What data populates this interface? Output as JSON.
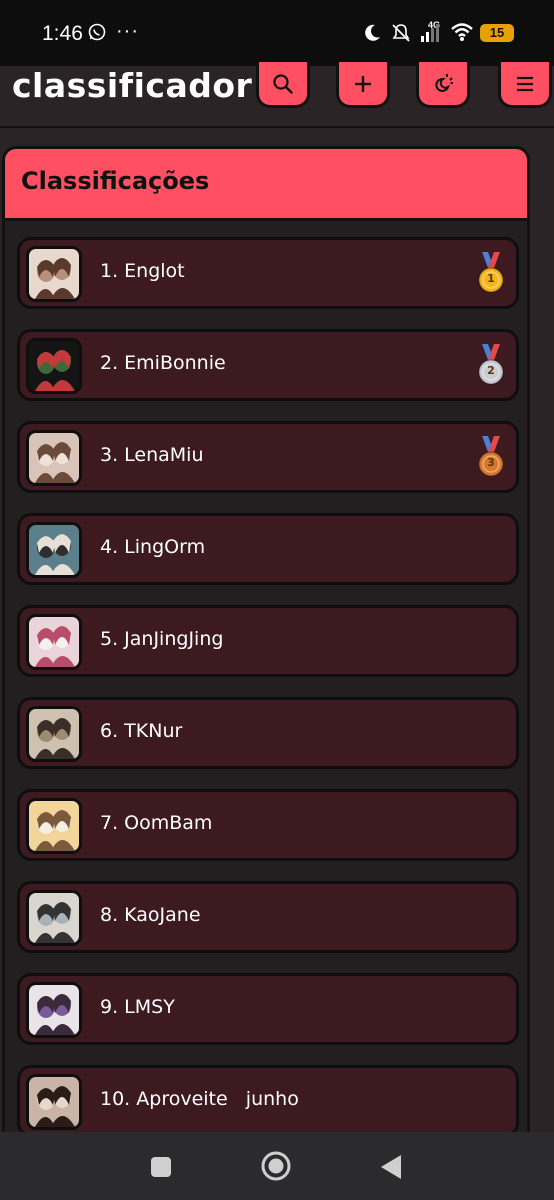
{
  "status_bar": {
    "time": "1:46",
    "more": "···",
    "network": "4G",
    "battery": "15"
  },
  "header": {
    "title": "classificador"
  },
  "panel": {
    "title": "Classificações"
  },
  "rankings": [
    {
      "label": "1. Englot",
      "medal": "gold",
      "medal_number": "1"
    },
    {
      "label": "2. EmiBonnie",
      "medal": "silver",
      "medal_number": "2"
    },
    {
      "label": "3. LenaMiu",
      "medal": "bronze",
      "medal_number": "3"
    },
    {
      "label": "4. LingOrm"
    },
    {
      "label": "5. JanJingJing"
    },
    {
      "label": "6. TKNur"
    },
    {
      "label": "7. OomBam"
    },
    {
      "label": "8. KaoJane"
    },
    {
      "label": "9. LMSY"
    },
    {
      "label": "10. Aproveite   junho"
    }
  ],
  "colors": {
    "accent": "#ff4f62",
    "item_bg": "#3c1a20",
    "panel_bg": "#231f20",
    "page_bg": "#2a2426",
    "gold": "#f2b51d",
    "silver": "#c9ccd2",
    "bronze": "#d9772a",
    "ribbon": "#4a7fd6"
  }
}
